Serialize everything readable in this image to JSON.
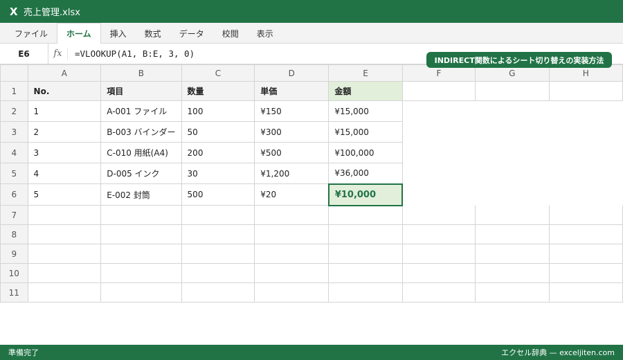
{
  "app": {
    "title": "売上管理.xlsx",
    "logo": "X",
    "logo_icon": "excel-logo-icon"
  },
  "ribbon": {
    "tabs": [
      "ファイル",
      "ホーム",
      "挿入",
      "数式",
      "データ",
      "校閲",
      "表示"
    ],
    "active_tab": "ホーム"
  },
  "formula_bar": {
    "name_box": "E6",
    "fx_label": "fx",
    "formula": "=VLOOKUP(A1, B:E, 3, 0)"
  },
  "badge": {
    "text": "INDIRECT関数によるシート切り替えの実装方法"
  },
  "sheet": {
    "columns": [
      "A",
      "B",
      "C",
      "D",
      "E",
      "F",
      "G",
      "H"
    ],
    "row_numbers": [
      "1",
      "2",
      "3",
      "4",
      "5",
      "6",
      "7",
      "8",
      "9",
      "10",
      "11"
    ],
    "header": [
      "No.",
      "項目",
      "数量",
      "単価",
      "金額"
    ],
    "rows": [
      [
        "1",
        "A-001 ファイル",
        "100",
        "¥150",
        "¥15,000"
      ],
      [
        "2",
        "B-003 バインダー",
        "50",
        "¥300",
        "¥15,000"
      ],
      [
        "3",
        "C-010 用紙(A4)",
        "200",
        "¥500",
        "¥100,000"
      ],
      [
        "4",
        "D-005 インク",
        "30",
        "¥1,200",
        "¥36,000"
      ],
      [
        "5",
        "E-002 封筒",
        "500",
        "¥20",
        "¥10,000"
      ]
    ],
    "selected_cell": "E6"
  },
  "status": {
    "left": "準備完了",
    "right": "エクセル辞典 — exceljiten.com"
  },
  "colors": {
    "brand": "#217346",
    "selected_fill": "#e2efda",
    "header_fill": "#f3f3f3",
    "grid_line": "#d4d4d4"
  }
}
